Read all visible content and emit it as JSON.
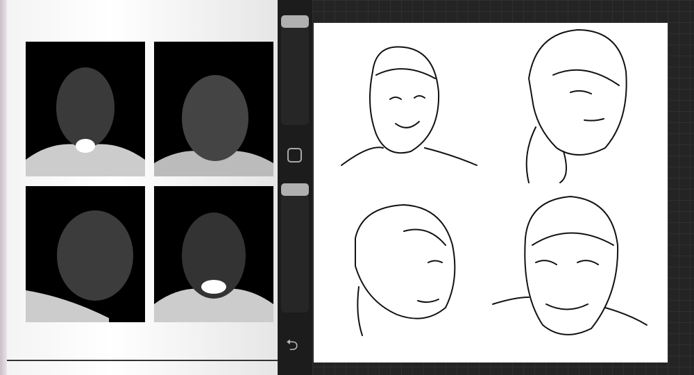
{
  "colors": {
    "sidebar": "#1c1c1c",
    "workspace": "#242424",
    "canvas": "#ffffff",
    "ink": "#111111",
    "thumb": "#b0b0b0"
  },
  "sidebar": {
    "brush_size": 1.0,
    "opacity": 1.0,
    "modify_icon": "square-icon",
    "undo_icon": "undo-arrow-icon"
  },
  "reference": {
    "photo_count": 4
  },
  "sketches": {
    "count": 4
  }
}
